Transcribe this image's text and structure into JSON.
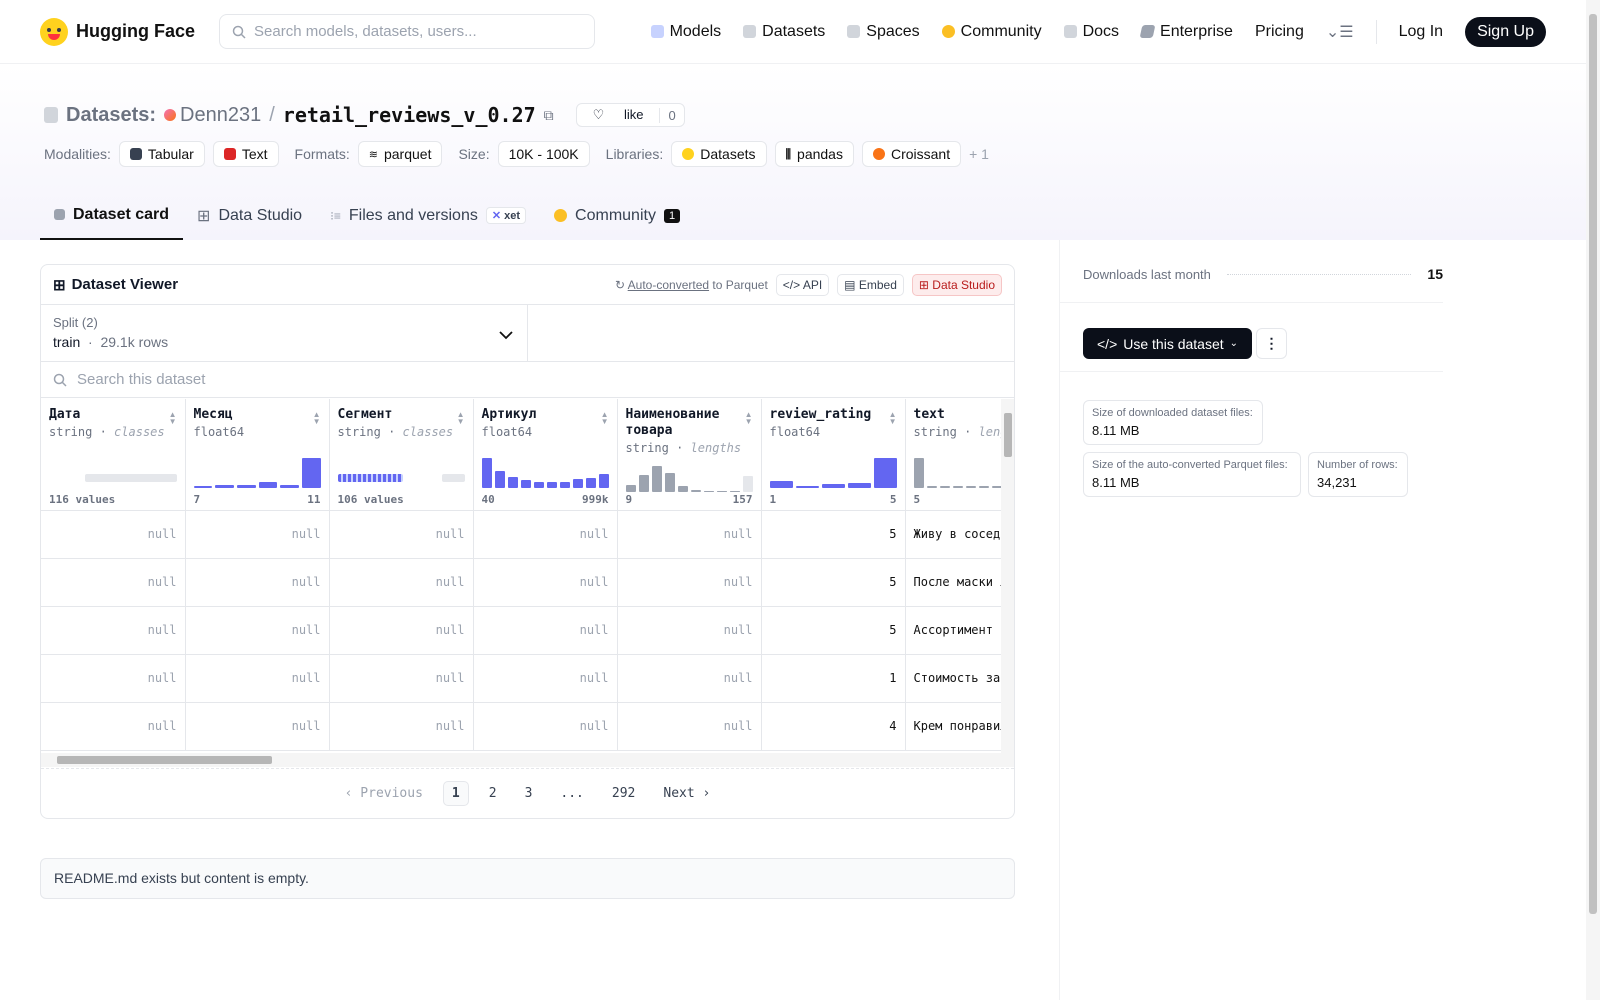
{
  "nav": {
    "brand": "Hugging Face",
    "search_placeholder": "Search models, datasets, users...",
    "links": {
      "models": "Models",
      "datasets": "Datasets",
      "spaces": "Spaces",
      "community": "Community",
      "docs": "Docs",
      "enterprise": "Enterprise",
      "pricing": "Pricing"
    },
    "login": "Log In",
    "signup": "Sign Up"
  },
  "header": {
    "section": "Datasets:",
    "user": "Denn231",
    "repo": "retail_reviews_v_0.27",
    "like_label": "like",
    "like_count": "0",
    "modalities_label": "Modalities:",
    "modalities": [
      "Tabular",
      "Text"
    ],
    "formats_label": "Formats:",
    "format": "parquet",
    "size_label": "Size:",
    "size": "10K - 100K",
    "libraries_label": "Libraries:",
    "libraries": [
      "Datasets",
      "pandas",
      "Croissant"
    ],
    "libraries_more": "+ 1"
  },
  "tabs": {
    "card": "Dataset card",
    "studio": "Data Studio",
    "files": "Files and versions",
    "xet": "xet",
    "community": "Community",
    "community_count": "1"
  },
  "viewer": {
    "title": "Dataset Viewer",
    "auto_converted": "Auto-converted",
    "to_parquet": "to Parquet",
    "api": "API",
    "embed": "Embed",
    "data_studio": "Data Studio",
    "split_label": "Split (2)",
    "split_name": "train",
    "split_rows": "29.1k rows",
    "search_placeholder": "Search this dataset",
    "columns": [
      {
        "name": "Дата",
        "type": "string",
        "kind": "classes",
        "summary": "116 values"
      },
      {
        "name": "Месяц",
        "type": "float64",
        "min": "7",
        "max": "11"
      },
      {
        "name": "Сегмент",
        "type": "string",
        "kind": "classes",
        "summary": "106 values"
      },
      {
        "name": "Артикул",
        "type": "float64",
        "min": "40",
        "max": "999k"
      },
      {
        "name": "Наименование товара",
        "type": "string",
        "kind": "lengths",
        "min": "9",
        "max": "157"
      },
      {
        "name": "review_rating",
        "type": "float64",
        "min": "1",
        "max": "5"
      },
      {
        "name": "text",
        "type": "string",
        "kind": "lengths",
        "min": "5"
      }
    ],
    "rows": [
      {
        "nulls": [
          "null",
          "null",
          "null",
          "null",
          "null"
        ],
        "rating": "5",
        "text": "Живу в соседнем доме,отличный"
      },
      {
        "nulls": [
          "null",
          "null",
          "null",
          "null",
          "null"
        ],
        "rating": "5",
        "text": "После маски лицо,свежее,…"
      },
      {
        "nulls": [
          "null",
          "null",
          "null",
          "null",
          "null"
        ],
        "rating": "5",
        "text": "Ассортимент и вежливость…"
      },
      {
        "nulls": [
          "null",
          "null",
          "null",
          "null",
          "null"
        ],
        "rating": "1",
        "text": "Стоимость зак изменилась пр"
      },
      {
        "nulls": [
          "null",
          "null",
          "null",
          "null",
          "null"
        ],
        "rating": "4",
        "text": "Крем понравил сильно тверда"
      }
    ],
    "pager": {
      "previous": "Previous",
      "pages": [
        "1",
        "2",
        "3",
        "...",
        "292"
      ],
      "next": "Next"
    }
  },
  "readme": "README.md exists but content is empty.",
  "sidebar": {
    "downloads_label": "Downloads last month",
    "downloads": "15",
    "use_button": "Use this dataset",
    "size_downloaded_label": "Size of downloaded dataset files:",
    "size_downloaded": "8.11 MB",
    "size_parquet_label": "Size of the auto-converted Parquet files:",
    "size_parquet": "8.11 MB",
    "num_rows_label": "Number of rows:",
    "num_rows": "34,231"
  },
  "histograms": {
    "month": [
      0.05,
      0.1,
      0.1,
      0.2,
      0.08,
      1.0
    ],
    "article": [
      1.0,
      0.55,
      0.35,
      0.25,
      0.2,
      0.18,
      0.2,
      0.28,
      0.33,
      0.45
    ],
    "name_lengths": [
      0.25,
      0.65,
      1.0,
      0.7,
      0.2,
      0.05,
      0.03,
      0.03,
      0.03,
      0.6
    ],
    "rating": [
      0.22,
      0.05,
      0.12,
      0.14,
      1.0
    ],
    "text_lengths": [
      1.0,
      0.05,
      0.05,
      0.05,
      0.05,
      0.05,
      0.05
    ]
  },
  "colors": {
    "accent": "#6366f1",
    "brand_yellow": "#ffd21e",
    "dark": "#0b0f19"
  }
}
